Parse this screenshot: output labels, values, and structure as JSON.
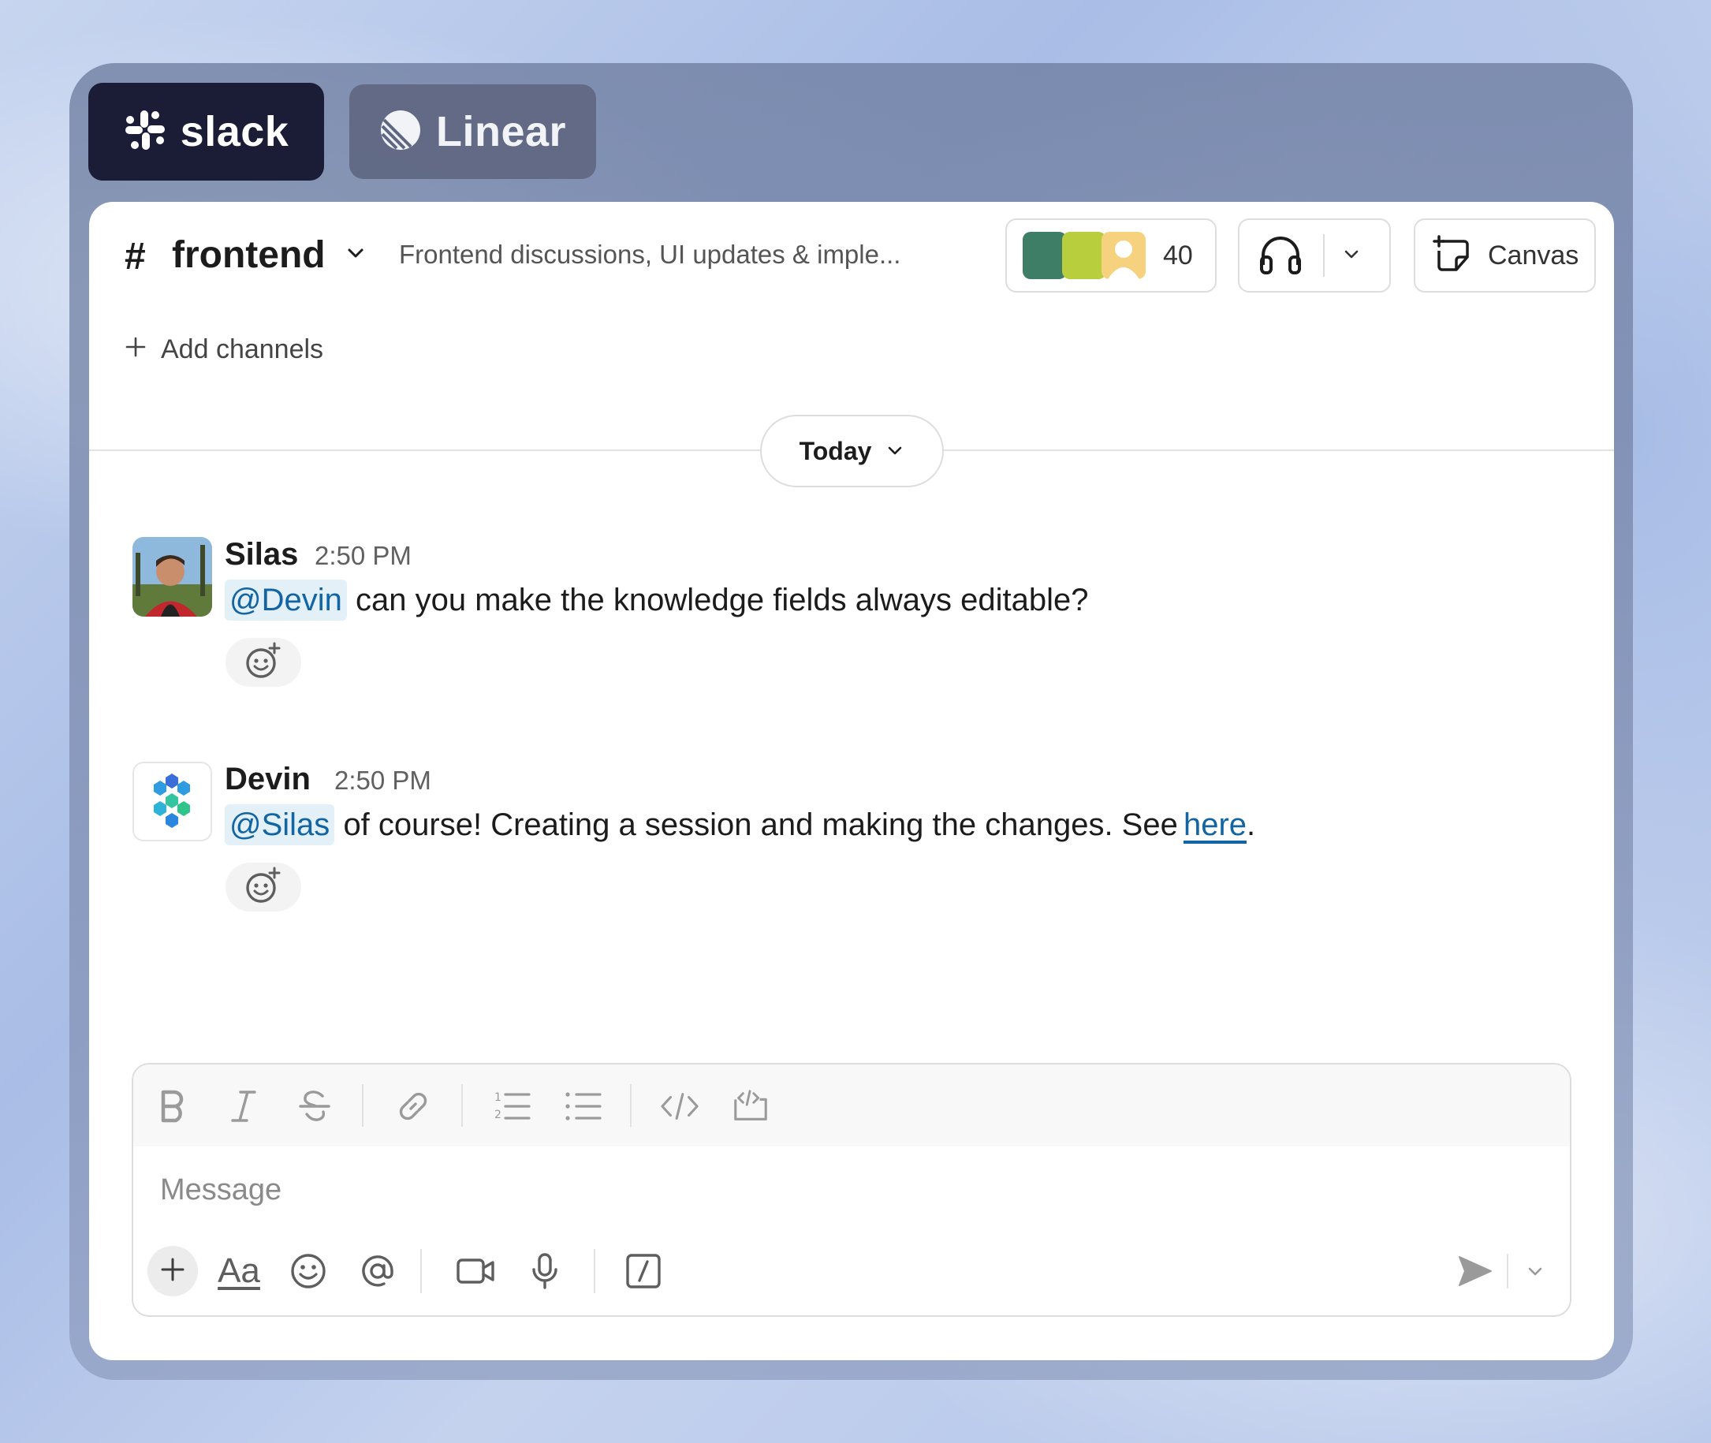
{
  "tabs": {
    "slack_label": "slack",
    "linear_label": "Linear"
  },
  "channel": {
    "hash": "#",
    "name": "frontend",
    "description": "Frontend discussions, UI updates & imple...",
    "member_count": "40",
    "canvas_label": "Canvas",
    "add_channels_label": "Add channels"
  },
  "date_divider": {
    "label": "Today"
  },
  "messages": [
    {
      "author": "Silas",
      "time": "2:50 PM",
      "mention": "@Devin",
      "text": "can you make the knowledge fields always editable?"
    },
    {
      "author": "Devin",
      "time": "2:50 PM",
      "mention": "@Silas",
      "text": "of course! Creating a session and making the changes. See",
      "link_text": "here",
      "trailing": "."
    }
  ],
  "composer": {
    "placeholder": "Message",
    "format_label": "Aa"
  },
  "icons": {
    "slack_logo": "slack-logo-icon",
    "linear_logo": "linear-logo-icon",
    "huddle": "headphones-icon",
    "canvas": "canvas-icon",
    "add_reaction": "add-reaction-icon",
    "bold": "bold-icon",
    "italic": "italic-icon",
    "strike": "strikethrough-icon",
    "link": "link-icon",
    "ordered_list": "ordered-list-icon",
    "bullet_list": "bullet-list-icon",
    "code": "code-icon",
    "code_block": "code-block-icon",
    "attach": "plus-icon",
    "emoji": "emoji-icon",
    "mention": "at-icon",
    "video": "video-icon",
    "mic": "microphone-icon",
    "shortcut": "slash-command-icon",
    "send": "send-icon"
  },
  "colors": {
    "slack_tab_bg": "#1b1d37",
    "mention_bg": "#e3f0f8",
    "mention_text": "#1264a3",
    "link": "#1264a3"
  }
}
